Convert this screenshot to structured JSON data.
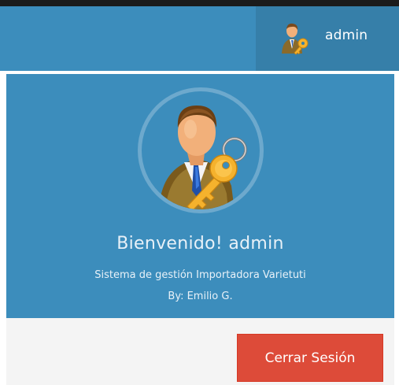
{
  "navbar": {
    "username": "admin",
    "avatar_icon": "user-admin-key-icon"
  },
  "user_header": {
    "avatar_icon": "user-admin-key-icon",
    "welcome": "Bienvenido! admin",
    "subtitle": "Sistema de gestión Importadora Varietuti",
    "byline": "By: Emilio G."
  },
  "footer": {
    "logout_label": "Cerrar Sesión"
  },
  "colors": {
    "primary": "#3c8dbc",
    "primary_dark": "#367fa9",
    "danger": "#dd4b39",
    "footer_bg": "#f4f4f4"
  }
}
